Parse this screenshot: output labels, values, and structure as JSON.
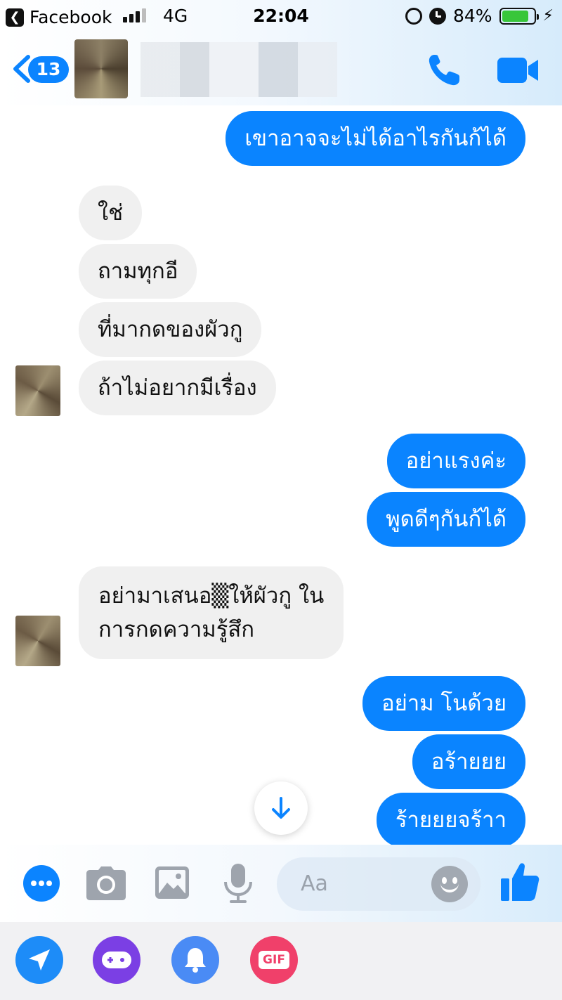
{
  "status_bar": {
    "back_app": "Facebook",
    "network": "4G",
    "time": "22:04",
    "battery": "84%",
    "battery_level": 0.84
  },
  "header": {
    "back_badge": "13"
  },
  "messages": [
    {
      "dir": "out",
      "text": "เขาอาจจะไม่ได้อาไรกันก้ได้"
    },
    {
      "dir": "in",
      "text": "ใช่"
    },
    {
      "dir": "in",
      "text": "ถามทุกอี"
    },
    {
      "dir": "in",
      "text": "ที่มากดของผัวกู"
    },
    {
      "dir": "in",
      "text": "ถ้าไม่อยากมีเรื่อง"
    },
    {
      "dir": "out",
      "text": "อย่าแรงค่ะ"
    },
    {
      "dir": "out",
      "text": "พูดดีๆกันก้ได้"
    },
    {
      "dir": "in",
      "line1": "อย่ามาเสนอ▒ให้ผัวกู ใน",
      "line2": "การกดความรู้สึก"
    },
    {
      "dir": "out",
      "text": "อย่าม โนด้วย"
    },
    {
      "dir": "out",
      "text": "อร้ายยย"
    },
    {
      "dir": "out",
      "text": "ร้ายยยจร้าา"
    }
  ],
  "composer": {
    "placeholder": "Aa"
  },
  "tray": {
    "gif_label": "GIF"
  },
  "colors": {
    "messenger_blue": "#0a84ff",
    "incoming_bubble": "#f0f0f0",
    "game_purple": "#7b3fe4",
    "bell_blue": "#4a8bf5",
    "gif_pink": "#f0406a"
  }
}
